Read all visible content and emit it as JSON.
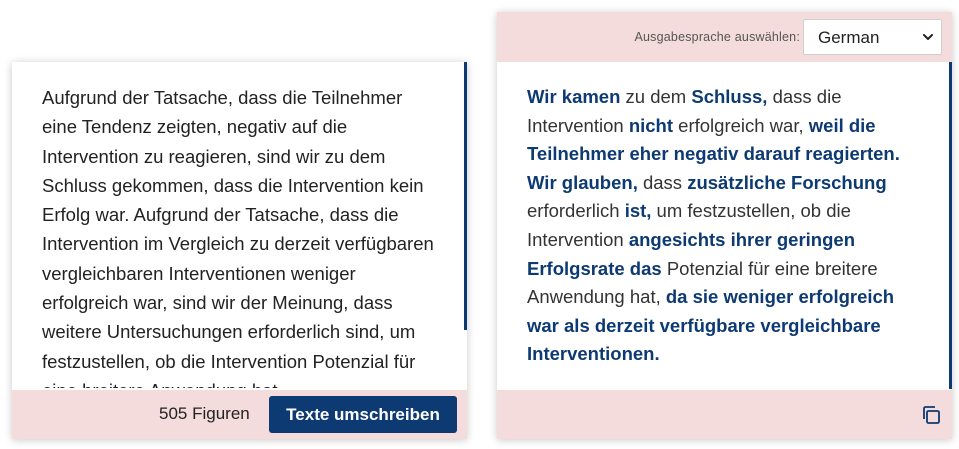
{
  "input": {
    "text": "Aufgrund der Tatsache, dass die Teilnehmer eine Tendenz zeigten, negativ auf die Intervention zu reagieren, sind wir zu dem Schluss gekommen, dass die Intervention kein Erfolg war. Aufgrund der Tatsache, dass die Intervention im Vergleich zu derzeit verfügbaren vergleichbaren Interventionen weniger erfolgreich war, sind wir der Meinung, dass weitere Untersuchungen erforderlich sind, um festzustellen, ob die Intervention Potenzial für eine breitere Anwendung hat."
  },
  "footer": {
    "figure_count": "505 Figuren",
    "rewrite_button": "Texte umschreiben"
  },
  "output": {
    "language_label": "Ausgabesprache auswählen:",
    "language_selected": "German",
    "segments": [
      {
        "text": "Wir kamen",
        "highlight": true
      },
      {
        "text": " zu dem ",
        "highlight": false
      },
      {
        "text": "Schluss,",
        "highlight": true
      },
      {
        "text": " dass die Intervention ",
        "highlight": false
      },
      {
        "text": "nicht",
        "highlight": true
      },
      {
        "text": " erfolgreich war, ",
        "highlight": false
      },
      {
        "text": "weil die Teilnehmer eher negativ darauf reagierten. Wir glauben,",
        "highlight": true
      },
      {
        "text": " dass ",
        "highlight": false
      },
      {
        "text": "zusätzliche Forschung",
        "highlight": true
      },
      {
        "text": " erforderlich ",
        "highlight": false
      },
      {
        "text": "ist,",
        "highlight": true
      },
      {
        "text": " um festzustellen, ob die Intervention ",
        "highlight": false
      },
      {
        "text": "angesichts ihrer geringen Erfolgsrate das",
        "highlight": true
      },
      {
        "text": " Potenzial für eine breitere Anwendung hat, ",
        "highlight": false
      },
      {
        "text": "da sie weniger erfolgreich war als derzeit verfügbare vergleichbare Interventionen.",
        "highlight": true
      }
    ]
  },
  "icons": {
    "copy": "copy-icon",
    "dropdown": "chevron-down-icon"
  },
  "colors": {
    "accent": "#0d3a73",
    "footer_bg": "#f3dcdb"
  }
}
